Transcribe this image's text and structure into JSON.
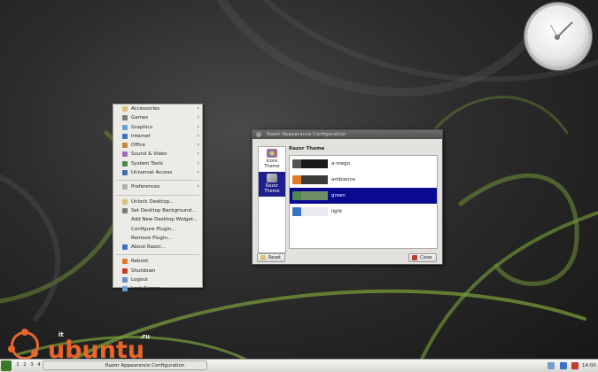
{
  "start_menu": {
    "items": [
      {
        "label": "Accessories",
        "submenu": true,
        "icon": "accessories-icon"
      },
      {
        "label": "Games",
        "submenu": true,
        "icon": "games-icon"
      },
      {
        "label": "Graphics",
        "submenu": true,
        "icon": "graphics-icon"
      },
      {
        "label": "Internet",
        "submenu": true,
        "icon": "internet-icon"
      },
      {
        "label": "Office",
        "submenu": true,
        "icon": "office-icon"
      },
      {
        "label": "Sound & Video",
        "submenu": true,
        "icon": "sound-video-icon"
      },
      {
        "label": "System Tools",
        "submenu": true,
        "icon": "system-tools-icon"
      },
      {
        "label": "Universal Access",
        "submenu": true,
        "icon": "universal-access-icon"
      },
      {
        "label": "Preferences",
        "submenu": true,
        "icon": "preferences-icon"
      },
      {
        "label": "Unlock Desktop...",
        "submenu": false,
        "icon": "unlock-icon"
      },
      {
        "label": "Set Desktop Background...",
        "submenu": false,
        "icon": "background-icon"
      },
      {
        "label": "Add New Desktop Widget...",
        "submenu": false,
        "icon": ""
      },
      {
        "label": "Configure Plugin...",
        "submenu": false,
        "icon": ""
      },
      {
        "label": "Remove Plugin...",
        "submenu": false,
        "icon": ""
      },
      {
        "label": "About Razor...",
        "submenu": false,
        "icon": "about-icon"
      },
      {
        "label": "Reboot",
        "submenu": false,
        "icon": "reboot-icon"
      },
      {
        "label": "Shutdown",
        "submenu": false,
        "icon": "shutdown-icon"
      },
      {
        "label": "Logout",
        "submenu": false,
        "icon": "logout-icon"
      },
      {
        "label": "Lock Screen",
        "submenu": false,
        "icon": "lock-screen-icon"
      }
    ]
  },
  "dialog": {
    "title": "Razor Appearance Configuration",
    "categories": [
      {
        "label1": "Icons",
        "label2": "Theme",
        "selected": false
      },
      {
        "label1": "Razor",
        "label2": "Theme",
        "selected": true
      }
    ],
    "section_header": "Razor Theme",
    "themes": [
      {
        "name": "a-mego",
        "preview_color": "#1a1a1a",
        "selected": false
      },
      {
        "name": "ambiance",
        "preview_color": "#3c3b37",
        "selected": false
      },
      {
        "name": "green",
        "preview_color": "#6f8f66",
        "selected": true
      },
      {
        "name": "light",
        "preview_color": "#e8eaf0",
        "selected": false
      }
    ],
    "reset_label": "Reset",
    "close_label": "Close"
  },
  "watermark": {
    "prefix": "it",
    "brand": "ubuntu",
    "suffix": ".ru"
  },
  "panel": {
    "desktops": [
      "1",
      "2",
      "3",
      "4"
    ],
    "task_label": "Razor Appearance Configuration",
    "clock": "14:00"
  },
  "colors": {
    "accent_selection": "#0a0a90",
    "ubuntu_orange": "#e8652c",
    "wallpaper_swirl": "#6b8a35"
  }
}
